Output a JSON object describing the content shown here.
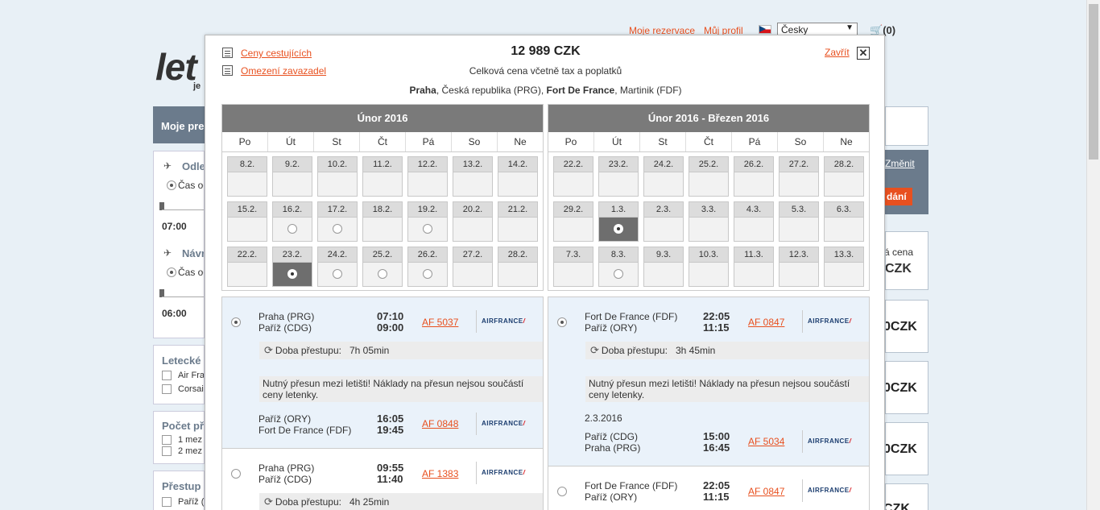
{
  "header": {
    "my_reservations": "Moje rezervace",
    "my_profile": "Můj profil",
    "language": "Česky",
    "cart": "(0)"
  },
  "background": {
    "logo": "let",
    "logo_sub": "je",
    "left_head": "Moje pre",
    "outbound_title": "Odle",
    "outbound_radio": "Čas od",
    "outbound_time": "07:00",
    "return_title": "Návr",
    "return_radio": "Čas od",
    "return_time": "06:00",
    "airlines_title": "Letecké s",
    "airline_1": "Air Fra",
    "airline_2": "Corsai",
    "stops_title": "Počet př",
    "stop_1": "1  mez",
    "stop_2": "2  mez",
    "transfer_title": "Přestup",
    "transfer_1": "Paříž (",
    "change_link": "Změnit",
    "order_btn": "dání",
    "total_label": "á cena",
    "total_value": "CZK",
    "prices": [
      "0CZK",
      "0CZK",
      "0CZK",
      "CZK"
    ]
  },
  "modal": {
    "passenger_prices": "Ceny cestujících",
    "baggage_limits": "Omezení zavazadel",
    "total_price": "12 989 CZK",
    "price_note": "Celková cena včetně tax a poplatků",
    "route_from_city": "Praha",
    "route_from_rest": ", Česká republika (PRG), ",
    "route_to_city": "Fort De France",
    "route_to_rest": ", Martinik (FDF)",
    "close": "Zavřít"
  },
  "calendars": [
    {
      "title": "Únor 2016",
      "weekdays": [
        "Po",
        "Út",
        "St",
        "Čt",
        "Pá",
        "So",
        "Ne"
      ],
      "weeks": [
        [
          "8.2.",
          "9.2.",
          "10.2.",
          "11.2.",
          "12.2.",
          "13.2.",
          "14.2."
        ],
        [
          "15.2.",
          "16.2.",
          "17.2.",
          "18.2.",
          "19.2.",
          "20.2.",
          "21.2."
        ],
        [
          "22.2.",
          "23.2.",
          "24.2.",
          "25.2.",
          "26.2.",
          "27.2.",
          "28.2."
        ]
      ]
    },
    {
      "title": "Únor 2016 - Březen 2016",
      "weekdays": [
        "Po",
        "Út",
        "St",
        "Čt",
        "Pá",
        "So",
        "Ne"
      ],
      "weeks": [
        [
          "22.2.",
          "23.2.",
          "24.2.",
          "25.2.",
          "26.2.",
          "27.2.",
          "28.2."
        ],
        [
          "29.2.",
          "1.3.",
          "2.3.",
          "3.3.",
          "4.3.",
          "5.3.",
          "6.3."
        ],
        [
          "7.3.",
          "8.3.",
          "9.3.",
          "10.3.",
          "11.3.",
          "12.3.",
          "13.3."
        ]
      ]
    }
  ],
  "outbound": {
    "option1": {
      "seg1_from": "Praha (PRG)",
      "seg1_to": "Paříž (CDG)",
      "seg1_dep": "07:10",
      "seg1_arr": "09:00",
      "seg1_flight": "AF 5037",
      "transfer_label": "Doba přestupu:",
      "transfer_time": "7h 05min",
      "warning": "Nutný přesun mezi letišti! Náklady na přesun nejsou součástí ceny letenky.",
      "seg2_from": "Paříž (ORY)",
      "seg2_to": "Fort De France (FDF)",
      "seg2_dep": "16:05",
      "seg2_arr": "19:45",
      "seg2_flight": "AF 0848"
    },
    "option2": {
      "seg1_from": "Praha (PRG)",
      "seg1_to": "Paříž (CDG)",
      "seg1_dep": "09:55",
      "seg1_arr": "11:40",
      "seg1_flight": "AF 1383",
      "transfer_label": "Doba přestupu:",
      "transfer_time": "4h 25min"
    }
  },
  "inbound": {
    "option1": {
      "seg1_from": "Fort De France (FDF)",
      "seg1_to": "Paříž (ORY)",
      "seg1_dep": "22:05",
      "seg1_arr": "11:15",
      "seg1_flight": "AF 0847",
      "transfer_label": "Doba přestupu:",
      "transfer_time": "3h 45min",
      "warning": "Nutný přesun mezi letišti! Náklady na přesun nejsou součástí ceny letenky.",
      "date": "2.3.2016",
      "seg2_from": "Paříž (CDG)",
      "seg2_to": "Praha (PRG)",
      "seg2_dep": "15:00",
      "seg2_arr": "16:45",
      "seg2_flight": "AF 5034"
    },
    "option2": {
      "seg1_from": "Fort De France (FDF)",
      "seg1_to": "Paříž (ORY)",
      "seg1_dep": "22:05",
      "seg1_arr": "11:15",
      "seg1_flight": "AF 0847"
    }
  },
  "airline_logo": "AIRFRANCE",
  "colors": {
    "accent": "#e8501f",
    "header_gray": "#7a7a7a",
    "selected": "#6e6e6e"
  }
}
